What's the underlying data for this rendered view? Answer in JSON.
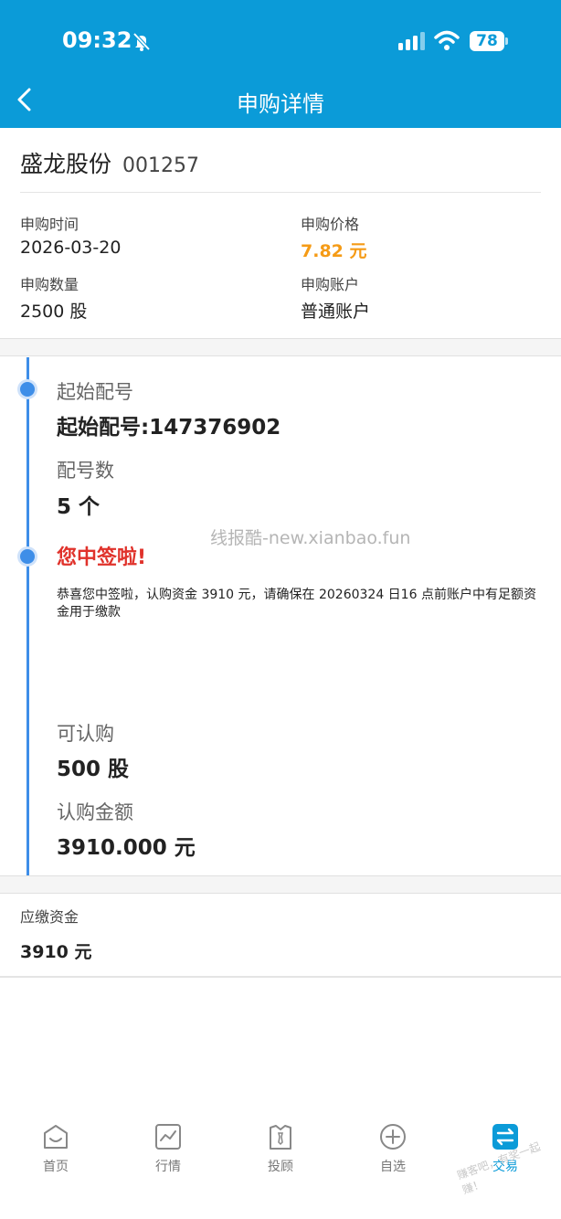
{
  "status_bar": {
    "time": "09:32",
    "battery": "78"
  },
  "header": {
    "title": "申购详情"
  },
  "stock": {
    "name": "盛龙股份",
    "code": "001257"
  },
  "info": {
    "subscribe_time": {
      "label": "申购时间",
      "value": "2026-03-20"
    },
    "subscribe_price": {
      "label": "申购价格",
      "value": "7.82 元"
    },
    "subscribe_quantity": {
      "label": "申购数量",
      "value": "2500 股"
    },
    "subscribe_account": {
      "label": "申购账户",
      "value": "普通账户"
    }
  },
  "timeline": {
    "start_no": {
      "label": "起始配号",
      "value": "起始配号:147376902"
    },
    "count": {
      "label": "配号数",
      "value": "5 个"
    },
    "win": {
      "title": "您中签啦!",
      "message": "恭喜您中签啦，认购资金 3910 元，请确保在 20260324 日16 点前账户中有足额资金用于缴款"
    },
    "available": {
      "label": "可认购",
      "value": "500 股"
    },
    "amount": {
      "label": "认购金额",
      "value": "3910.000 元"
    }
  },
  "watermark": "线报酷-new.xianbao.fun",
  "due": {
    "label": "应缴资金",
    "value": "3910 元"
  },
  "tabbar": {
    "items": [
      {
        "label": "首页",
        "icon": "home-icon"
      },
      {
        "label": "行情",
        "icon": "chart-icon"
      },
      {
        "label": "投顾",
        "icon": "advisor-icon"
      },
      {
        "label": "自选",
        "icon": "add-circle-icon"
      },
      {
        "label": "交易",
        "icon": "trade-icon",
        "active": true
      }
    ]
  },
  "corner_watermark": "赚客吧，有奖一起赚！",
  "colors": {
    "header": "#0b9bd8",
    "accent_blue": "#3e8ee8",
    "price": "#f59b16",
    "win": "#e0322b"
  }
}
